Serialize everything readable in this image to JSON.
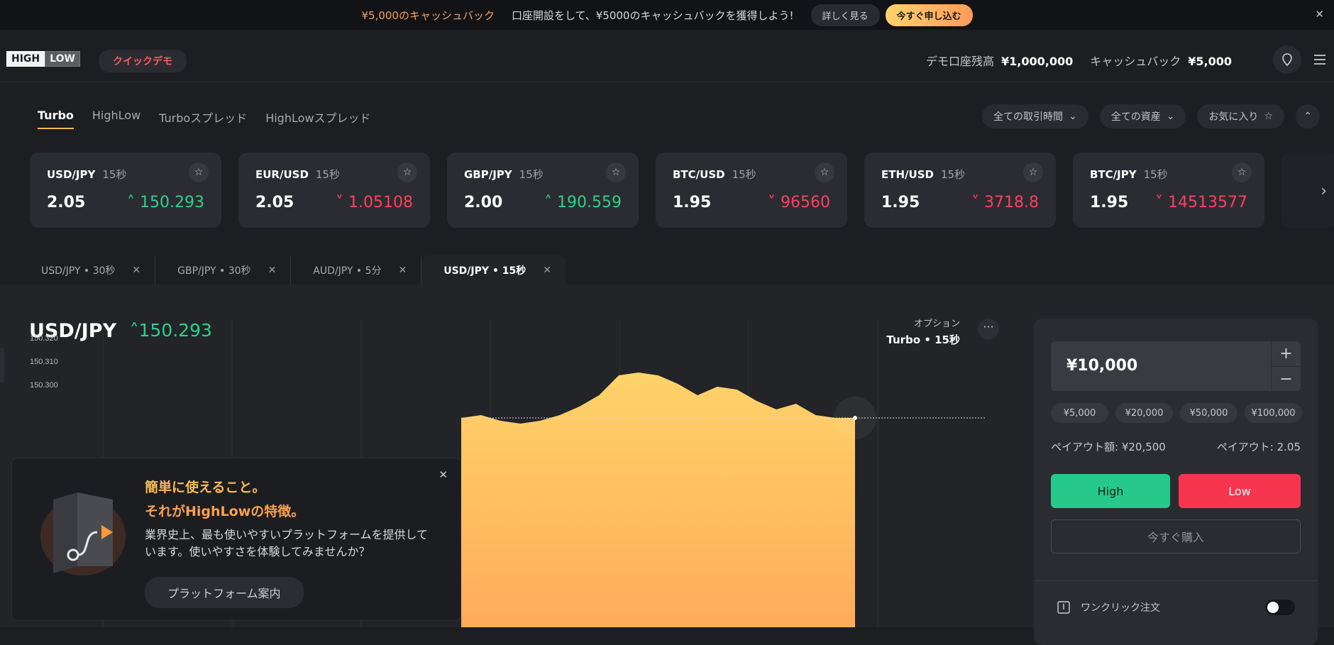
{
  "banner": {
    "highlight": "¥5,000のキャッシュバック",
    "text": "口座開設をして、¥5000のキャッシュバックを獲得しよう!",
    "detail_label": "詳しく見る",
    "apply_label": "今すぐ申し込む",
    "close_icon": "close-icon"
  },
  "header": {
    "logo_high": "HIGH",
    "logo_low": "LOW",
    "quick_demo": "クイックデモ",
    "demo_balance_label": "デモ口座残高",
    "demo_balance_value": "¥1,000,000",
    "cashback_label": "キャッシュバック",
    "cashback_value": "¥5,000",
    "icons": [
      "location-pin-icon",
      "menu-icon"
    ]
  },
  "asset_tabs": [
    "Turbo",
    "HighLow",
    "Turboスプレッド",
    "HighLowスプレッド"
  ],
  "filters": {
    "time": "全ての取引時間",
    "assets": "全ての資産",
    "favorites": "お気に入り"
  },
  "cards": [
    {
      "name": "USD/JPY",
      "time": "15秒",
      "payout": "2.05",
      "price": "150.293",
      "dir": "up"
    },
    {
      "name": "EUR/USD",
      "time": "15秒",
      "payout": "2.05",
      "price": "1.05108",
      "dir": "down"
    },
    {
      "name": "GBP/JPY",
      "time": "15秒",
      "payout": "2.00",
      "price": "190.559",
      "dir": "up"
    },
    {
      "name": "BTC/USD",
      "time": "15秒",
      "payout": "1.95",
      "price": "96560",
      "dir": "down"
    },
    {
      "name": "ETH/USD",
      "time": "15秒",
      "payout": "1.95",
      "price": "3718.8",
      "dir": "down"
    },
    {
      "name": "BTC/JPY",
      "time": "15秒",
      "payout": "1.95",
      "price": "14513577",
      "dir": "down"
    }
  ],
  "chart_tabs": [
    {
      "label": "USD/JPY • 30秒",
      "active": false
    },
    {
      "label": "GBP/JPY • 30秒",
      "active": false
    },
    {
      "label": "AUD/JPY • 5分",
      "active": false
    },
    {
      "label": "USD/JPY • 15秒",
      "active": true
    }
  ],
  "main": {
    "symbol": "USD/JPY",
    "price": "150.293",
    "option_label": "オプション",
    "option_value": "Turbo • 15秒",
    "more": "···"
  },
  "chart_data": {
    "type": "area",
    "y_ticks": [
      "150.320",
      "150.310",
      "150.300"
    ],
    "ylim": [
      150.28,
      150.325
    ],
    "fill_colors": [
      "#ffd36a",
      "#ffab5a"
    ],
    "values": [
      150.293,
      150.294,
      150.292,
      150.291,
      150.292,
      150.294,
      150.297,
      150.301,
      150.308,
      150.309,
      150.308,
      150.305,
      150.301,
      150.304,
      150.303,
      150.299,
      150.296,
      150.298,
      150.294,
      150.293,
      150.293
    ]
  },
  "trade": {
    "amount": "¥10,000",
    "plus": "+",
    "minus": "−",
    "presets": [
      "¥5,000",
      "¥20,000",
      "¥50,000",
      "¥100,000"
    ],
    "payout_amount": "ペイアウト額: ¥20,500",
    "payout_rate": "ペイアウト: 2.05",
    "high_label": "High",
    "low_label": "Low",
    "buy_label": "今すぐ購入",
    "one_click": "ワンクリック注文"
  },
  "popup": {
    "title1": "簡単に使えること。",
    "title2": "それがHighLowの特徴。",
    "body": "業界史上、最も使いやすいプラットフォームを提供しています。使いやすさを体験してみませんか？",
    "guide_label": "プラットフォーム案内"
  }
}
